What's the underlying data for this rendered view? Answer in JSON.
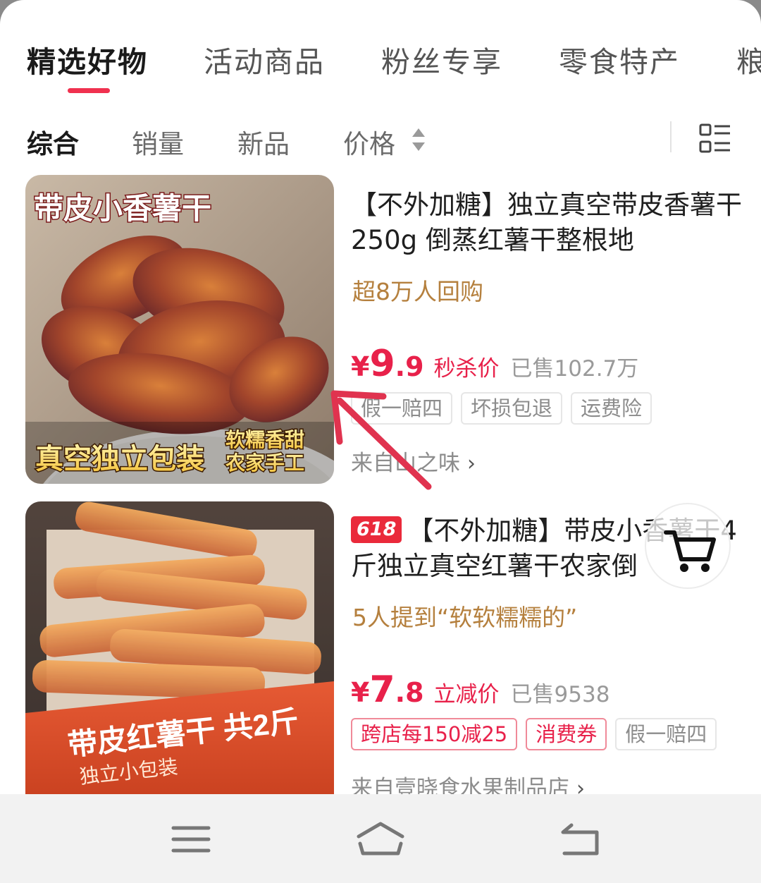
{
  "category_tabs": [
    {
      "label": "精选好物",
      "active": true
    },
    {
      "label": "活动商品",
      "active": false
    },
    {
      "label": "粉丝专享",
      "active": false
    },
    {
      "label": "零食特产",
      "active": false
    },
    {
      "label": "粮",
      "active": false
    }
  ],
  "sort_bar": {
    "items": [
      {
        "label": "综合",
        "active": true
      },
      {
        "label": "销量",
        "active": false
      },
      {
        "label": "新品",
        "active": false
      },
      {
        "label": "价格",
        "active": false
      }
    ],
    "layout_toggle_icon": "list-grid-icon"
  },
  "products": [
    {
      "image_text_top": "带皮小香薯干",
      "image_text_bottom": "真空独立包装",
      "image_text_side": "软糯香甜\n农家手工",
      "badge": "",
      "title": "【不外加糖】独立真空带皮香薯干250g 倒蒸红薯干整根地",
      "subline": "超8万人回购",
      "currency": "¥",
      "price_int": "9",
      "price_dec": ".9",
      "price_tag": "秒杀价",
      "sold": "已售102.7万",
      "tags": [
        {
          "label": "假一赔四",
          "style": "gray"
        },
        {
          "label": "坏损包退",
          "style": "gray"
        },
        {
          "label": "运费险",
          "style": "gray"
        }
      ],
      "store": "来自山之味"
    },
    {
      "image_text_main": "带皮红薯干 共2斤",
      "image_text_sub": "独立小包装",
      "badge": "618",
      "title": "【不外加糖】带皮小香薯干4斤独立真空红薯干农家倒",
      "subline": "5人提到“软软糯糯的”",
      "currency": "¥",
      "price_int": "7",
      "price_dec": ".8",
      "price_tag": "立减价",
      "sold": "已售9538",
      "tags": [
        {
          "label": "跨店每150减25",
          "style": "red"
        },
        {
          "label": "消费券",
          "style": "red"
        },
        {
          "label": "假一赔四",
          "style": "gray"
        }
      ],
      "store": "来自壹晓食水果制品店"
    }
  ],
  "cart_icon": "shopping-cart-icon",
  "system_nav": {
    "menu_icon": "menu-icon",
    "home_icon": "home-icon",
    "back_icon": "back-icon"
  },
  "colors": {
    "accent": "#f0314f",
    "price": "#e8214a",
    "subline": "#b5803e",
    "tag_border": "#e6e6e6",
    "annotation": "#e0334f"
  }
}
